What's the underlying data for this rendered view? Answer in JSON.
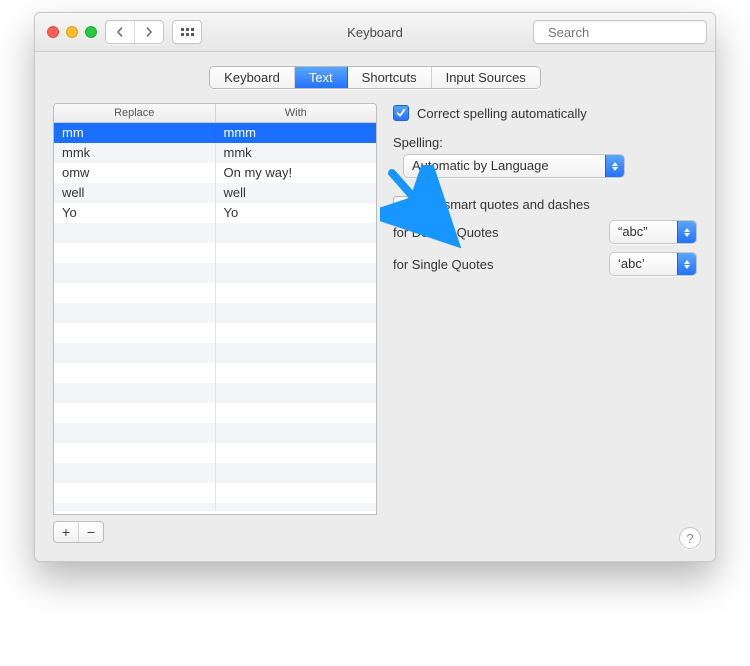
{
  "window": {
    "title": "Keyboard",
    "search_placeholder": "Search"
  },
  "tabs": [
    {
      "label": "Keyboard",
      "active": false
    },
    {
      "label": "Text",
      "active": true
    },
    {
      "label": "Shortcuts",
      "active": false
    },
    {
      "label": "Input Sources",
      "active": false
    }
  ],
  "table": {
    "columns": {
      "replace": "Replace",
      "with": "With"
    },
    "rows": [
      {
        "replace": "mm",
        "with": "mmm",
        "selected": true
      },
      {
        "replace": "mmk",
        "with": "mmk",
        "selected": false
      },
      {
        "replace": "omw",
        "with": "On my way!",
        "selected": false
      },
      {
        "replace": "well",
        "with": "well",
        "selected": false
      },
      {
        "replace": "Yo",
        "with": "Yo",
        "selected": false
      }
    ]
  },
  "buttons": {
    "add": "+",
    "remove": "−"
  },
  "options": {
    "correct_spelling": {
      "label": "Correct spelling automatically",
      "checked": true
    },
    "spelling_heading": "Spelling:",
    "spelling_value": "Automatic by Language",
    "smart_quotes": {
      "label": "Use smart quotes and dashes",
      "checked": false
    },
    "double_quotes": {
      "label": "for Double Quotes",
      "value": "“abc”"
    },
    "single_quotes": {
      "label": "for Single Quotes",
      "value": "‘abc’"
    }
  },
  "help_glyph": "?"
}
